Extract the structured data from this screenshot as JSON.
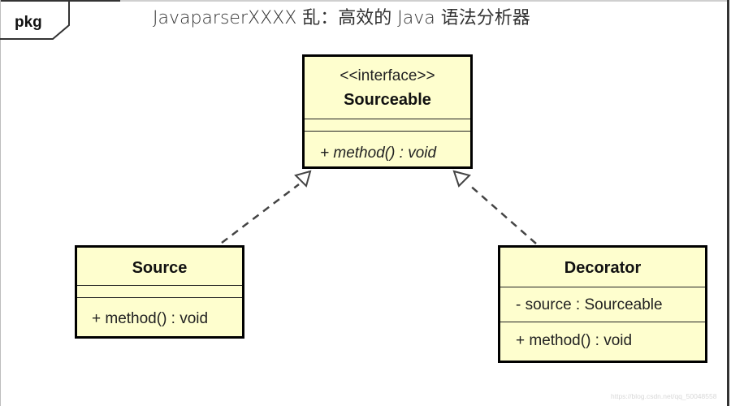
{
  "page_title": "JavaparserXXXX 乱：高效的 Java 语法分析器",
  "package": {
    "label": "pkg"
  },
  "classes": {
    "sourceable": {
      "stereotype": "<<interface>>",
      "name": "Sourceable",
      "attributes": [],
      "operations": [
        "+ method() : void"
      ]
    },
    "source": {
      "name": "Source",
      "attributes": [],
      "operations": [
        "+ method() : void"
      ]
    },
    "decorator": {
      "name": "Decorator",
      "attributes": [
        "- source : Sourceable"
      ],
      "operations": [
        "+ method() : void"
      ]
    }
  },
  "relations": [
    {
      "type": "realization",
      "from": "Source",
      "to": "Sourceable"
    },
    {
      "type": "realization",
      "from": "Decorator",
      "to": "Sourceable"
    }
  ],
  "colors": {
    "class_fill": "#fefece",
    "class_border": "#000000"
  },
  "watermark": "https://blog.csdn.net/qq_50048558"
}
